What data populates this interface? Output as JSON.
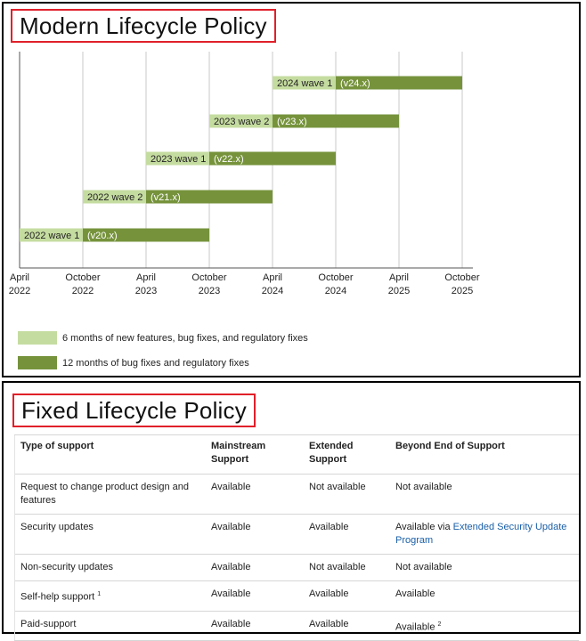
{
  "modern": {
    "title": "Modern Lifecycle Policy",
    "axis_ticks": [
      {
        "month": "April",
        "year": "2022"
      },
      {
        "month": "October",
        "year": "2022"
      },
      {
        "month": "April",
        "year": "2023"
      },
      {
        "month": "October",
        "year": "2023"
      },
      {
        "month": "April",
        "year": "2024"
      },
      {
        "month": "October",
        "year": "2024"
      },
      {
        "month": "April",
        "year": "2025"
      },
      {
        "month": "October",
        "year": "2025"
      }
    ],
    "waves": [
      {
        "name": "2022 wave 1",
        "version": "(v20.x)",
        "start": "2022-04",
        "features_end": "2022-10",
        "support_end": "2023-10"
      },
      {
        "name": "2022 wave 2",
        "version": "(v21.x)",
        "start": "2022-10",
        "features_end": "2023-04",
        "support_end": "2024-04"
      },
      {
        "name": "2023 wave 1",
        "version": "(v22.x)",
        "start": "2023-04",
        "features_end": "2023-10",
        "support_end": "2024-10"
      },
      {
        "name": "2023 wave 2",
        "version": "(v23.x)",
        "start": "2023-10",
        "features_end": "2024-04",
        "support_end": "2025-04"
      },
      {
        "name": "2024 wave 1",
        "version": "(v24.x)",
        "start": "2024-04",
        "features_end": "2024-10",
        "support_end": "2025-10"
      }
    ],
    "legend": [
      {
        "label": "6 months of new features, bug fixes, and regulatory fixes",
        "color": "#c5dca0"
      },
      {
        "label": "12 months of bug fixes and regulatory fixes",
        "color": "#76933c"
      }
    ],
    "colors": {
      "features": "#c5dca0",
      "support": "#76933c",
      "grid": "#c8c8c8"
    }
  },
  "fixed": {
    "title": "Fixed Lifecycle Policy",
    "headers": {
      "type": "Type of support",
      "mainstream": [
        "Mainstream",
        "Support"
      ],
      "extended": [
        "Extended",
        "Support"
      ],
      "beyond": "Beyond End of Support"
    },
    "rows": [
      {
        "type": "Request to change product design and features",
        "mainstream": "Available",
        "extended": "Not available",
        "beyond": "Not available"
      },
      {
        "type": "Security updates",
        "mainstream": "Available",
        "extended": "Available",
        "beyond_prefix": "Available via ",
        "beyond_link": "Extended Security Update Program"
      },
      {
        "type": "Non-security updates",
        "mainstream": "Available",
        "extended": "Not available",
        "beyond": "Not available"
      },
      {
        "type": "Self-help support",
        "type_sup": "1",
        "mainstream": "Available",
        "extended": "Available",
        "beyond": "Available"
      },
      {
        "type": "Paid-support",
        "mainstream": "Available",
        "extended": "Available",
        "beyond": "Available",
        "beyond_sup": "2"
      }
    ]
  }
}
